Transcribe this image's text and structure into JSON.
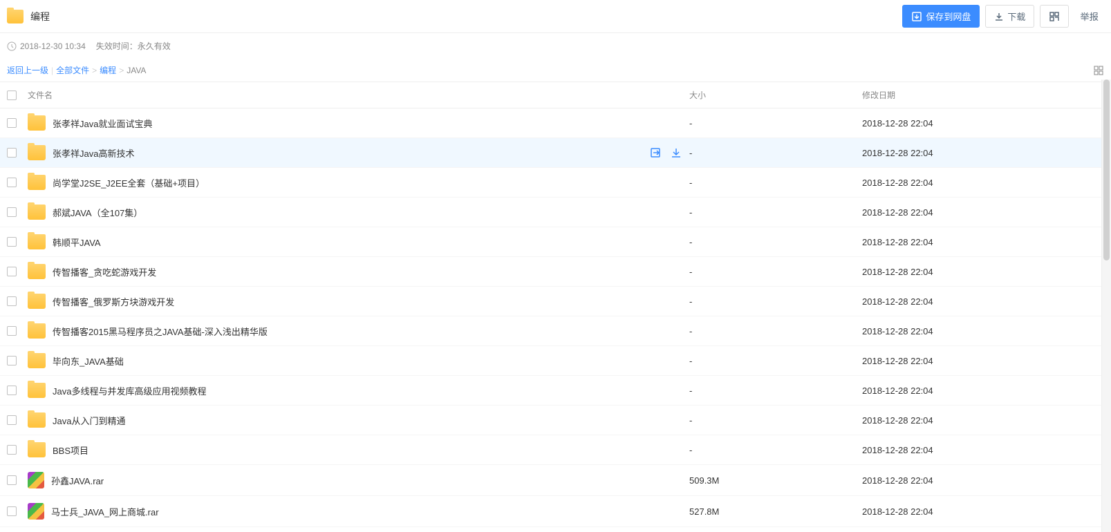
{
  "header": {
    "title": "编程",
    "save_button": "保存到网盘",
    "download_button": "下载",
    "report_button": "举报"
  },
  "meta": {
    "timestamp": "2018-12-30 10:34",
    "expire_label": "失效时间：永久有效"
  },
  "breadcrumb": {
    "back": "返回上一级",
    "all_files": "全部文件",
    "programming": "编程",
    "current": "JAVA"
  },
  "columns": {
    "name": "文件名",
    "size": "大小",
    "date": "修改日期"
  },
  "files": [
    {
      "name": "张孝祥Java就业面试宝典",
      "type": "folder",
      "size": "-",
      "date": "2018-12-28 22:04",
      "hover": false
    },
    {
      "name": "张孝祥Java高新技术",
      "type": "folder",
      "size": "-",
      "date": "2018-12-28 22:04",
      "hover": true
    },
    {
      "name": "尚学堂J2SE_J2EE全套（基础+项目）",
      "type": "folder",
      "size": "-",
      "date": "2018-12-28 22:04",
      "hover": false
    },
    {
      "name": "郝斌JAVA（全107集）",
      "type": "folder",
      "size": "-",
      "date": "2018-12-28 22:04",
      "hover": false
    },
    {
      "name": "韩顺平JAVA",
      "type": "folder",
      "size": "-",
      "date": "2018-12-28 22:04",
      "hover": false
    },
    {
      "name": "传智播客_贪吃蛇游戏开发",
      "type": "folder",
      "size": "-",
      "date": "2018-12-28 22:04",
      "hover": false
    },
    {
      "name": "传智播客_俄罗斯方块游戏开发",
      "type": "folder",
      "size": "-",
      "date": "2018-12-28 22:04",
      "hover": false
    },
    {
      "name": "传智播客2015黑马程序员之JAVA基础-深入浅出精华版",
      "type": "folder",
      "size": "-",
      "date": "2018-12-28 22:04",
      "hover": false
    },
    {
      "name": "毕向东_JAVA基础",
      "type": "folder",
      "size": "-",
      "date": "2018-12-28 22:04",
      "hover": false
    },
    {
      "name": "Java多线程与并发库高级应用视频教程",
      "type": "folder",
      "size": "-",
      "date": "2018-12-28 22:04",
      "hover": false
    },
    {
      "name": "Java从入门到精通",
      "type": "folder",
      "size": "-",
      "date": "2018-12-28 22:04",
      "hover": false
    },
    {
      "name": "BBS项目",
      "type": "folder",
      "size": "-",
      "date": "2018-12-28 22:04",
      "hover": false
    },
    {
      "name": "孙鑫JAVA.rar",
      "type": "rar",
      "size": "509.3M",
      "date": "2018-12-28 22:04",
      "hover": false
    },
    {
      "name": "马士兵_JAVA_网上商城.rar",
      "type": "rar",
      "size": "527.8M",
      "date": "2018-12-28 22:04",
      "hover": false
    }
  ]
}
